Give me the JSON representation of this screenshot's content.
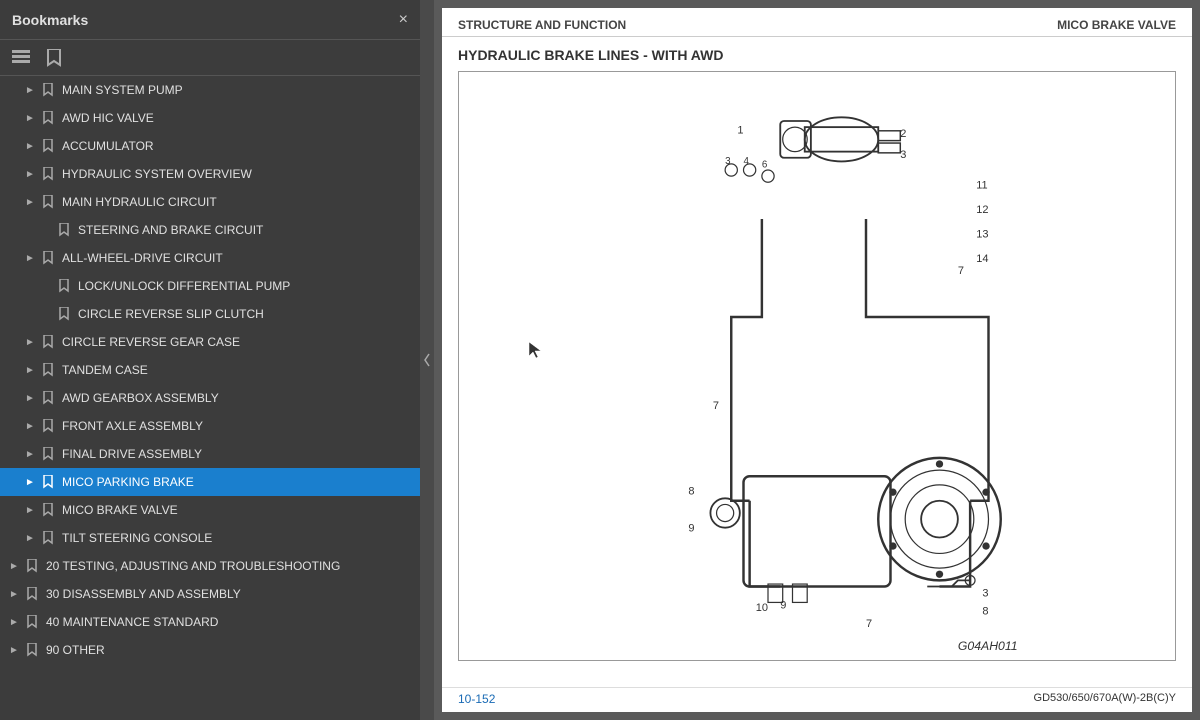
{
  "sidebar": {
    "title": "Bookmarks",
    "close_label": "×",
    "items": [
      {
        "id": "main-system-pump",
        "label": "MAIN SYSTEM PUMP",
        "indent": 1,
        "has_chevron": true,
        "active": false
      },
      {
        "id": "awd-hic-valve",
        "label": "AWD HIC VALVE",
        "indent": 1,
        "has_chevron": true,
        "active": false
      },
      {
        "id": "accumulator",
        "label": "ACCUMULATOR",
        "indent": 1,
        "has_chevron": true,
        "active": false
      },
      {
        "id": "hydraulic-system-overview",
        "label": "HYDRAULIC SYSTEM OVERVIEW",
        "indent": 1,
        "has_chevron": true,
        "active": false
      },
      {
        "id": "main-hydraulic-circuit",
        "label": "MAIN HYDRAULIC CIRCUIT",
        "indent": 1,
        "has_chevron": true,
        "active": false
      },
      {
        "id": "steering-and-brake-circuit",
        "label": "STEERING AND BRAKE CIRCUIT",
        "indent": 2,
        "has_chevron": false,
        "active": false
      },
      {
        "id": "all-wheel-drive-circuit",
        "label": "ALL-WHEEL-DRIVE CIRCUIT",
        "indent": 1,
        "has_chevron": true,
        "active": false
      },
      {
        "id": "lock-unlock-diff-pump",
        "label": "LOCK/UNLOCK DIFFERENTIAL PUMP",
        "indent": 2,
        "has_chevron": false,
        "active": false
      },
      {
        "id": "circle-reverse-slip-clutch",
        "label": "CIRCLE REVERSE SLIP CLUTCH",
        "indent": 2,
        "has_chevron": false,
        "active": false
      },
      {
        "id": "circle-reverse-gear-case",
        "label": "CIRCLE REVERSE GEAR CASE",
        "indent": 1,
        "has_chevron": true,
        "active": false
      },
      {
        "id": "tandem-case",
        "label": "TANDEM CASE",
        "indent": 1,
        "has_chevron": true,
        "active": false
      },
      {
        "id": "awd-gearbox-assembly",
        "label": "AWD GEARBOX ASSEMBLY",
        "indent": 1,
        "has_chevron": true,
        "active": false
      },
      {
        "id": "front-axle-assembly",
        "label": "FRONT AXLE ASSEMBLY",
        "indent": 1,
        "has_chevron": true,
        "active": false
      },
      {
        "id": "final-drive-assembly",
        "label": "FINAL DRIVE ASSEMBLY",
        "indent": 1,
        "has_chevron": true,
        "active": false
      },
      {
        "id": "mico-parking-brake",
        "label": "MICO PARKING BRAKE",
        "indent": 1,
        "has_chevron": true,
        "active": true
      },
      {
        "id": "mico-brake-valve",
        "label": "MICO BRAKE VALVE",
        "indent": 1,
        "has_chevron": true,
        "active": false
      },
      {
        "id": "tilt-steering-console",
        "label": "TILT STEERING CONSOLE",
        "indent": 1,
        "has_chevron": true,
        "active": false
      },
      {
        "id": "20-testing",
        "label": "20 TESTING, ADJUSTING AND TROUBLESHOOTING",
        "indent": 0,
        "has_chevron": true,
        "active": false
      },
      {
        "id": "30-disassembly",
        "label": "30 DISASSEMBLY AND ASSEMBLY",
        "indent": 0,
        "has_chevron": true,
        "active": false
      },
      {
        "id": "40-maintenance",
        "label": "40 MAINTENANCE STANDARD",
        "indent": 0,
        "has_chevron": true,
        "active": false
      },
      {
        "id": "90-other",
        "label": "90 OTHER",
        "indent": 0,
        "has_chevron": true,
        "active": false
      }
    ]
  },
  "doc": {
    "header_left": "STRUCTURE AND FUNCTION",
    "header_right": "MICO BRAKE VALVE",
    "subtitle": "HYDRAULIC BRAKE LINES - WITH AWD",
    "footer_left": "10-152",
    "footer_right": "GD530/650/670A(W)-2B(C)Y",
    "diagram_ref": "G04AH011"
  }
}
